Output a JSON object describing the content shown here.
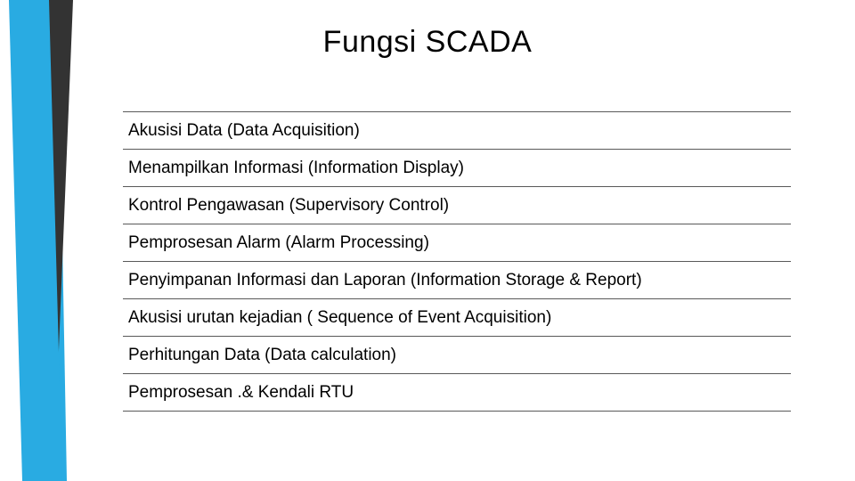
{
  "title": "Fungsi SCADA",
  "items": [
    "Akusisi Data (Data Acquisition)",
    "Menampilkan Informasi (Information Display)",
    "Kontrol Pengawasan (Supervisory Control)",
    "Pemprosesan Alarm (Alarm Processing)",
    "Penyimpanan Informasi dan Laporan (Information Storage & Report)",
    "Akusisi urutan kejadian ( Sequence of Event Acquisition)",
    "Perhitungan Data (Data calculation)",
    "Pemprosesan .& Kendali RTU"
  ],
  "colors": {
    "accent_blue": "#29abe2",
    "accent_dark": "#333333"
  }
}
